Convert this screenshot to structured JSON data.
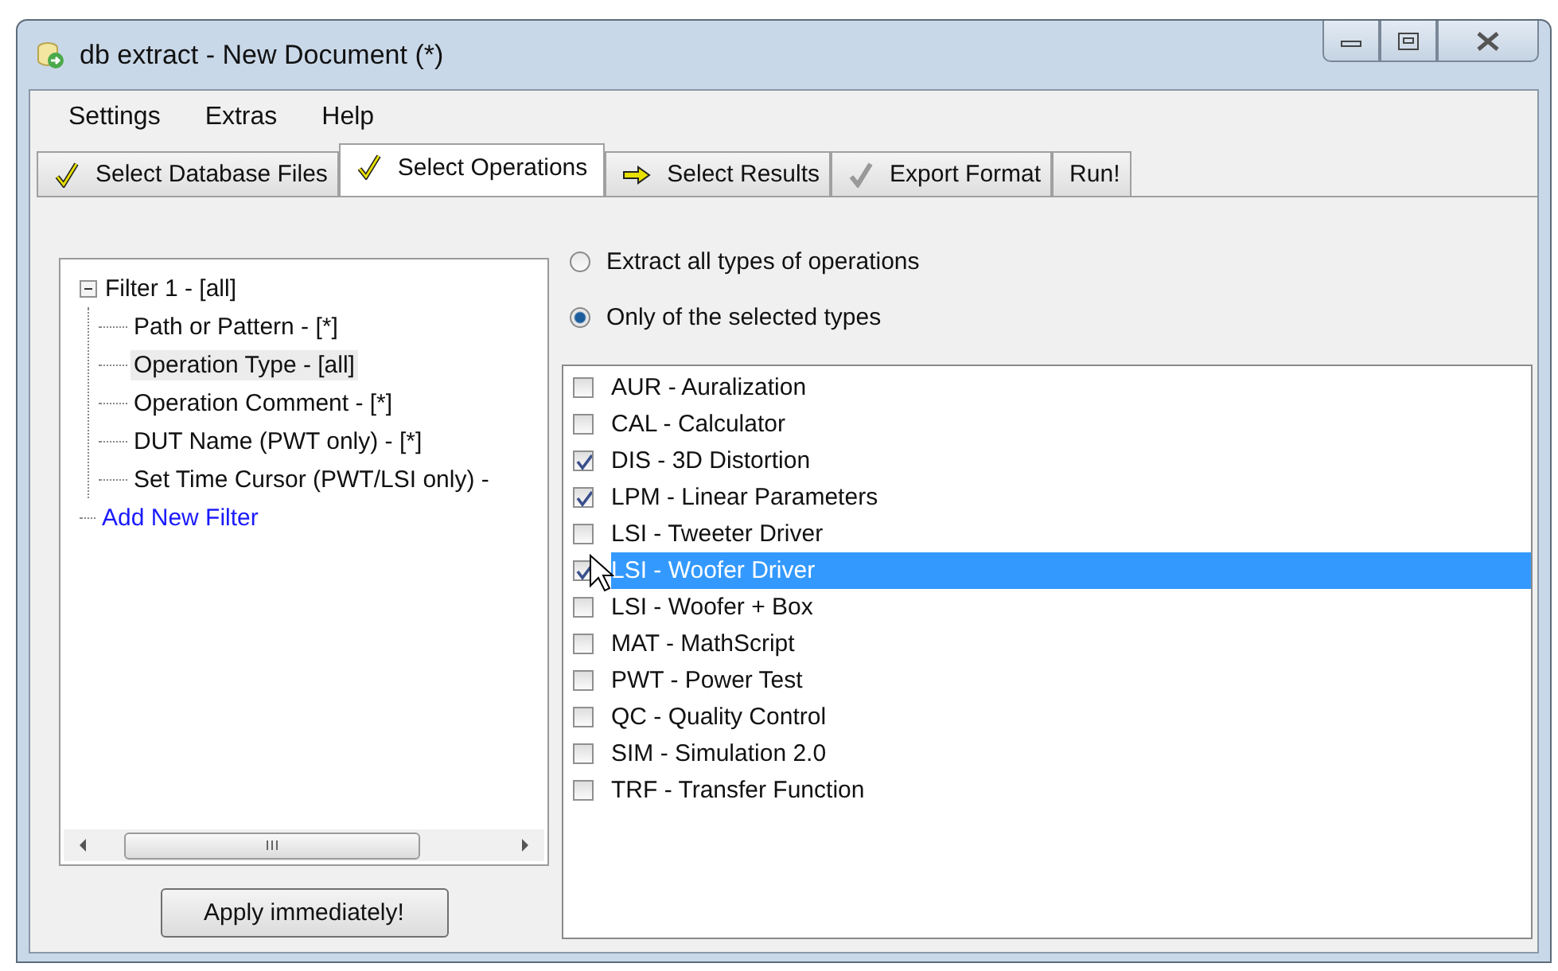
{
  "window": {
    "title": "db extract - New Document (*)"
  },
  "menu": [
    "Settings",
    "Extras",
    "Help"
  ],
  "tabs": [
    {
      "label": "Select Database Files",
      "kind": "check",
      "selected": false
    },
    {
      "label": "Select Operations",
      "kind": "check",
      "selected": true
    },
    {
      "label": "Select Results",
      "kind": "arrow",
      "selected": false
    },
    {
      "label": "Export Format",
      "kind": "check-dim",
      "selected": false
    },
    {
      "label": "Run!",
      "kind": "plain",
      "selected": false
    }
  ],
  "tree": [
    {
      "label": "Filter 1 - [all]",
      "kind": "node",
      "expanded": true,
      "selected": false,
      "children": [
        {
          "label": "Path or Pattern - [*]",
          "selected": false
        },
        {
          "label": "Operation Type - [all]",
          "selected": true
        },
        {
          "label": "Operation Comment - [*]",
          "selected": false
        },
        {
          "label": "DUT Name (PWT only) - [*]",
          "selected": false
        },
        {
          "label": "Set Time Cursor (PWT/LSI only) -",
          "selected": false
        }
      ]
    },
    {
      "label": "Add New Filter",
      "kind": "link",
      "selected": false
    }
  ],
  "apply_button": "Apply immediately!",
  "radios": [
    {
      "label": "Extract all types of operations",
      "selected": false
    },
    {
      "label": "Only of the selected types",
      "selected": true
    }
  ],
  "types": [
    {
      "label": "AUR - Auralization",
      "checked": false,
      "selected": false
    },
    {
      "label": "CAL - Calculator",
      "checked": false,
      "selected": false
    },
    {
      "label": "DIS - 3D Distortion",
      "checked": true,
      "selected": false
    },
    {
      "label": "LPM - Linear Parameters",
      "checked": true,
      "selected": false
    },
    {
      "label": "LSI - Tweeter Driver",
      "checked": false,
      "selected": false
    },
    {
      "label": "LSI - Woofer Driver",
      "checked": true,
      "selected": true
    },
    {
      "label": "LSI - Woofer + Box",
      "checked": false,
      "selected": false
    },
    {
      "label": "MAT - MathScript",
      "checked": false,
      "selected": false
    },
    {
      "label": "PWT - Power Test",
      "checked": false,
      "selected": false
    },
    {
      "label": "QC - Quality Control",
      "checked": false,
      "selected": false
    },
    {
      "label": "SIM - Simulation 2.0",
      "checked": false,
      "selected": false
    },
    {
      "label": "TRF - Transfer Function",
      "checked": false,
      "selected": false
    }
  ]
}
